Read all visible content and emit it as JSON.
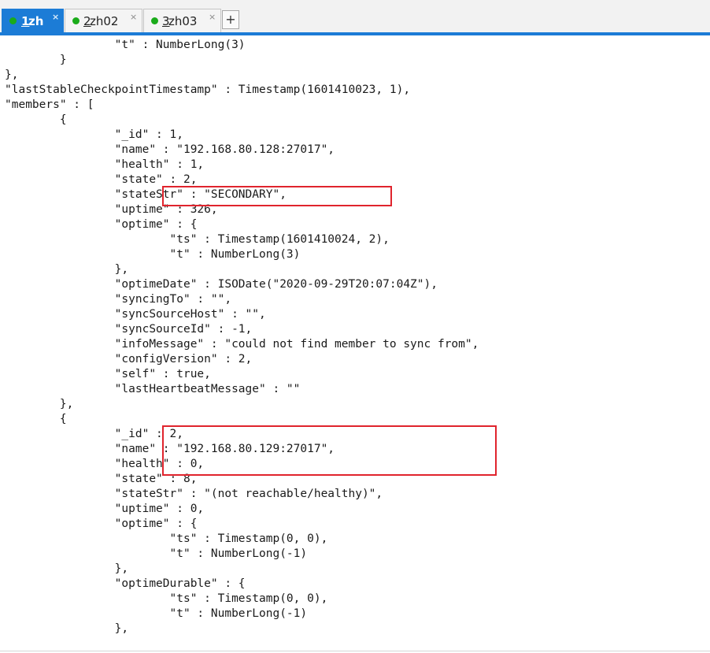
{
  "tabs": [
    {
      "num": "1",
      "name": " zh",
      "active": true
    },
    {
      "num": "2",
      "name": " zh02",
      "active": false
    },
    {
      "num": "3",
      "name": " zh03",
      "active": false
    }
  ],
  "tab_close": "×",
  "add_tab": "+",
  "colors": {
    "accent": "#1c7cd6",
    "status_dot": "#1aab1a",
    "highlight_box": "#e0242d"
  },
  "terminal_lines": [
    "                \"t\" : NumberLong(3)",
    "        }",
    "},",
    "\"lastStableCheckpointTimestamp\" : Timestamp(1601410023, 1),",
    "\"members\" : [",
    "        {",
    "                \"_id\" : 1,",
    "                \"name\" : \"192.168.80.128:27017\",",
    "                \"health\" : 1,",
    "                \"state\" : 2,",
    "                \"stateStr\" : \"SECONDARY\",",
    "                \"uptime\" : 326,",
    "                \"optime\" : {",
    "                        \"ts\" : Timestamp(1601410024, 2),",
    "                        \"t\" : NumberLong(3)",
    "                },",
    "                \"optimeDate\" : ISODate(\"2020-09-29T20:07:04Z\"),",
    "                \"syncingTo\" : \"\",",
    "                \"syncSourceHost\" : \"\",",
    "                \"syncSourceId\" : -1,",
    "                \"infoMessage\" : \"could not find member to sync from\",",
    "                \"configVersion\" : 2,",
    "                \"self\" : true,",
    "                \"lastHeartbeatMessage\" : \"\"",
    "        },",
    "        {",
    "                \"_id\" : 2,",
    "                \"name\" : \"192.168.80.129:27017\",",
    "                \"health\" : 0,",
    "                \"state\" : 8,",
    "                \"stateStr\" : \"(not reachable/healthy)\",",
    "                \"uptime\" : 0,",
    "                \"optime\" : {",
    "                        \"ts\" : Timestamp(0, 0),",
    "                        \"t\" : NumberLong(-1)",
    "                },",
    "                \"optimeDurable\" : {",
    "                        \"ts\" : Timestamp(0, 0),",
    "                        \"t\" : NumberLong(-1)",
    "                },"
  ]
}
